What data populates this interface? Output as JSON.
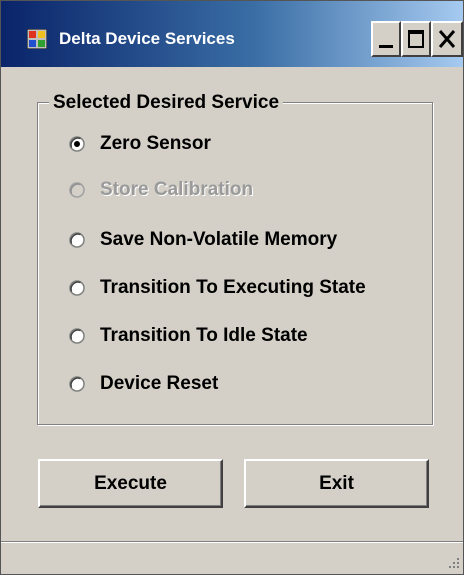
{
  "window": {
    "title": "Delta Device Services",
    "icon": "application-icon",
    "caption_buttons": [
      "minimize-icon",
      "maximize-icon",
      "close-icon"
    ]
  },
  "group": {
    "caption": "Selected Desired Service",
    "options": [
      {
        "label": "Zero Sensor",
        "checked": true,
        "enabled": true
      },
      {
        "label": "Store Calibration",
        "checked": false,
        "enabled": false
      },
      {
        "label": "Save Non-Volatile Memory",
        "checked": false,
        "enabled": true
      },
      {
        "label": "Transition To Executing State",
        "checked": false,
        "enabled": true
      },
      {
        "label": "Transition To Idle State",
        "checked": false,
        "enabled": true
      },
      {
        "label": "Device Reset",
        "checked": false,
        "enabled": true
      }
    ]
  },
  "buttons": {
    "execute_label": "Execute",
    "exit_label": "Exit"
  },
  "colors": {
    "face": "#d4d0c8",
    "title_start": "#0a246a",
    "title_end": "#a6caf0",
    "disabled_text": "#9a9a9a"
  }
}
